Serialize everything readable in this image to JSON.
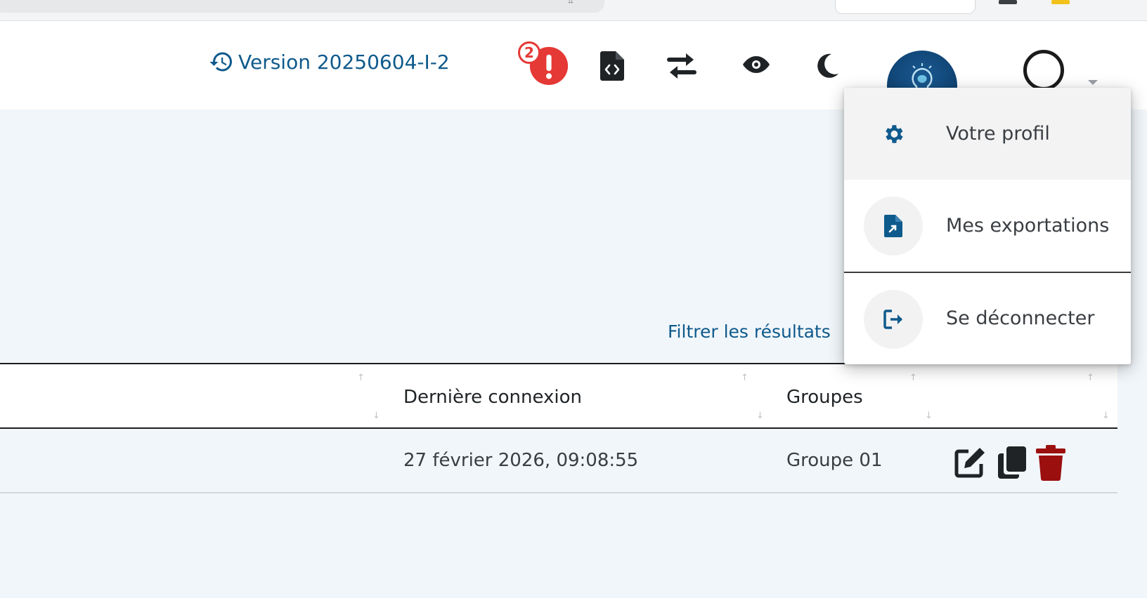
{
  "header": {
    "version_label": "Version 20250604-I-2",
    "alert_count": "2"
  },
  "filter": {
    "label": "Filtrer les résultats"
  },
  "table": {
    "columns": [
      "Dernière connexion",
      "Groupes"
    ],
    "rows": [
      {
        "last_login": "27 février 2026, 09:08:55",
        "group": "Groupe 01"
      }
    ]
  },
  "user_menu": {
    "items": [
      {
        "label": "Votre profil",
        "icon": "gear-icon",
        "active": true
      },
      {
        "label": "Mes exportations",
        "icon": "file-export-icon",
        "active": false
      },
      {
        "label": "Se déconnecter",
        "icon": "logout-icon",
        "active": false
      }
    ]
  },
  "colors": {
    "accent": "#0f5a8c",
    "alert": "#e53935",
    "delete": "#9b0f0f",
    "background": "#f1f6fa"
  }
}
